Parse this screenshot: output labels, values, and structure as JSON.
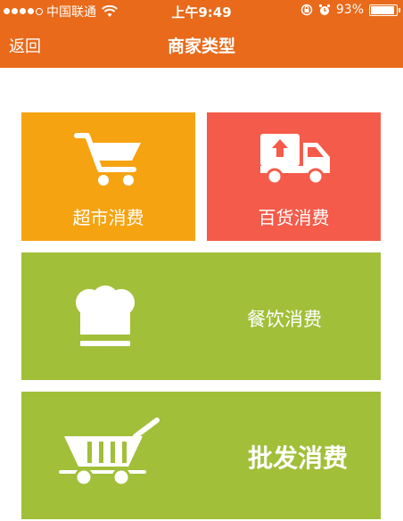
{
  "status_bar": {
    "carrier": "中国联通",
    "time": "上午9:49",
    "battery": "93%"
  },
  "nav": {
    "back_label": "返回",
    "title": "商家类型"
  },
  "tiles": [
    {
      "label": "超市消费",
      "icon": "shopping-cart-icon",
      "color": "#f6a312"
    },
    {
      "label": "百货消费",
      "icon": "delivery-truck-icon",
      "color": "#f55b4a"
    },
    {
      "label": "餐饮消费",
      "icon": "chef-hat-icon",
      "color": "#a1bf39"
    },
    {
      "label": "批发消费",
      "icon": "wholesale-cart-icon",
      "color": "#a1bf39"
    }
  ],
  "colors": {
    "header": "#e86a1a",
    "background": "#ffffff"
  }
}
